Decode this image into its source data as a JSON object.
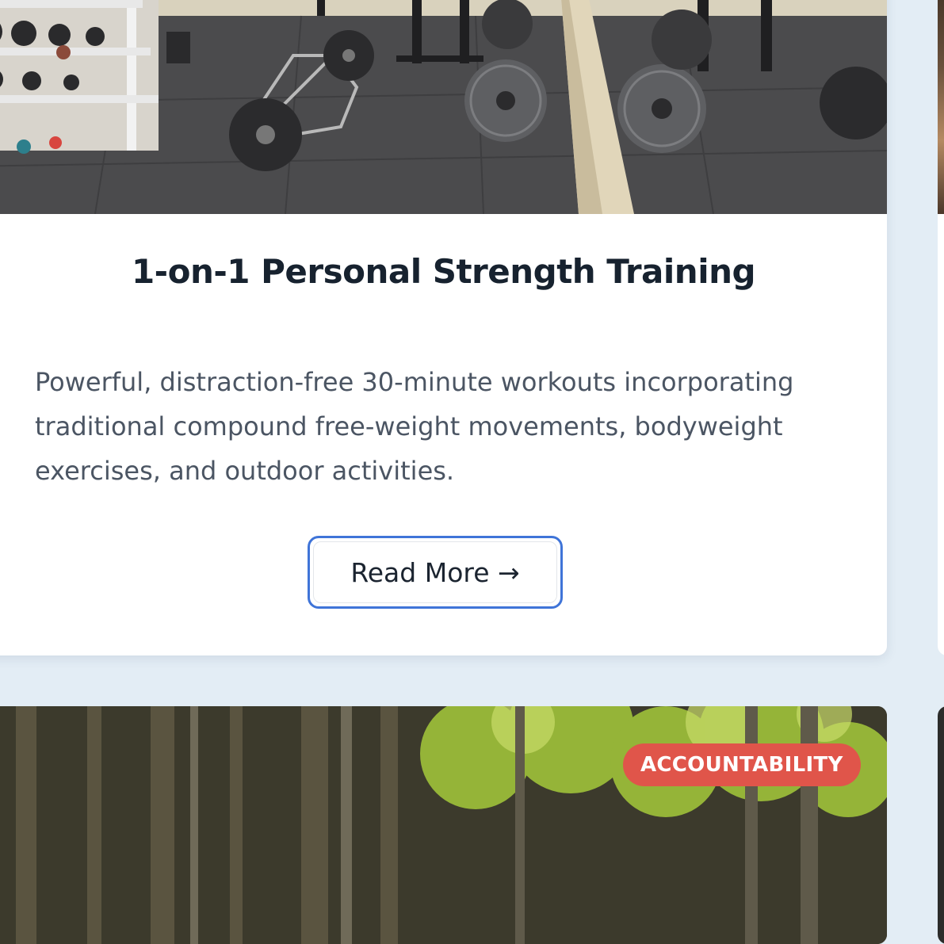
{
  "card": {
    "image_alt": "home gym with barbell plates",
    "title": "1-on-1 Personal Strength Training",
    "description": "Powerful, distraction-free 30-minute workouts incorporating traditional compound free-weight movements, bodyweight exercises, and outdoor activities.",
    "button_label": "Read More →"
  },
  "next_card": {
    "badge": "ACCOUNTABILITY"
  },
  "colors": {
    "page_bg": "#e3edf5",
    "title": "#17222f",
    "body_text": "#4b5563",
    "button_focus_ring": "#3f74d8",
    "badge_bg": "#e0554a"
  }
}
